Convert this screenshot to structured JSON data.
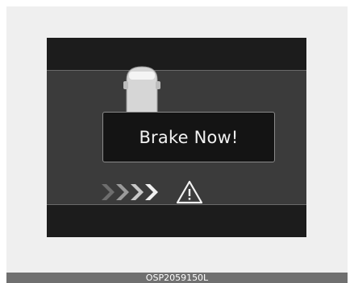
{
  "display": {
    "message": "Brake Now!",
    "icons": {
      "chevrons": "approach-chevrons-icon",
      "warning": "warning-triangle-icon",
      "vehicle": "vehicle-ahead-icon"
    },
    "chevron_colors": [
      "#6e6e6e",
      "#9a9a9a",
      "#c8c8c8",
      "#f0f0f0"
    ]
  },
  "figure": {
    "code": "OSP2059150L"
  }
}
